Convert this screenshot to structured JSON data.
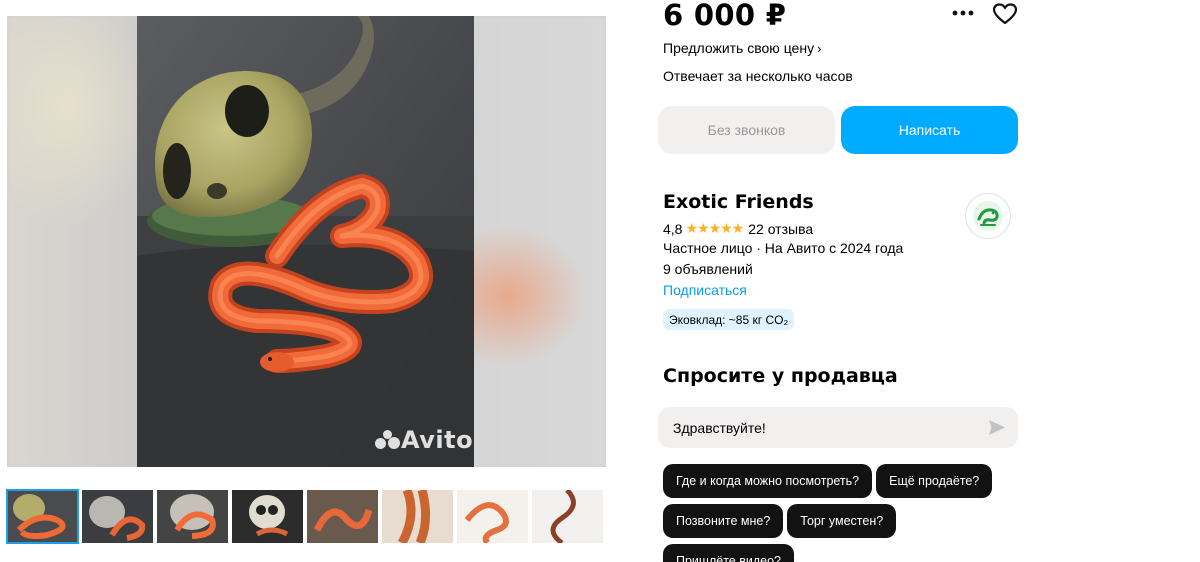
{
  "gallery": {
    "watermark": "Avito",
    "thumbnails_count": 8
  },
  "listing": {
    "price": "6 000 ₽",
    "offer_price": "Предложить свою цену",
    "response_time": "Отвечает за несколько часов",
    "no_calls_label": "Без звонков",
    "write_label": "Написать"
  },
  "seller": {
    "name": "Exotic Friends",
    "rating": "4,8",
    "stars": "★★★★★",
    "reviews": "22 отзыва",
    "type": "Частное лицо · На Авито с 2024 года",
    "listings": "9 объявлений",
    "subscribe": "Подписаться",
    "eco": "Эковклад: ~85 кг CO₂"
  },
  "ask": {
    "title": "Спросите у продавца",
    "message_value": "Здравствуйте!",
    "chips": [
      "Где и когда можно посмотреть?",
      "Ещё продаёте?",
      "Позвоните мне?",
      "Торг уместен?",
      "Пришлёте видео?"
    ]
  },
  "colors": {
    "accent": "#00aaff",
    "link": "#0a9ef0",
    "star": "#ffb021",
    "chip_bg": "#121212",
    "secondary_bg": "#f2efef"
  },
  "icons": [
    "more-icon",
    "heart-icon",
    "chevron-right-icon",
    "send-icon",
    "avito-logo-icon"
  ]
}
